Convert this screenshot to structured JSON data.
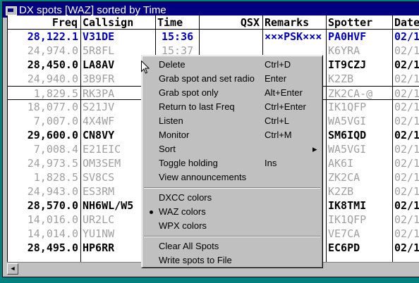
{
  "window": {
    "title": "DX spots [WAZ] sorted by Time"
  },
  "columns": [
    "Freq",
    "Callsign",
    "Time",
    "QSX",
    "Remarks",
    "Spotter",
    "Date"
  ],
  "rows": [
    {
      "freq": "28,122.1",
      "call": "V31DE",
      "time": "15:36",
      "qsx": "",
      "remarks": "×××PSK×××",
      "spotter": "PA0HVF",
      "date": "02/1"
    },
    {
      "freq": "24,974.0",
      "call": "5R8FL",
      "time": "15:37",
      "qsx": "",
      "remarks": "",
      "spotter": "K6YRA",
      "date": "02/1"
    },
    {
      "freq": "28,450.0",
      "call": "LA8AV",
      "time": "",
      "qsx": "",
      "remarks": "",
      "spotter": "IT9CZJ",
      "date": "02/1"
    },
    {
      "freq": "24,940.0",
      "call": "3B9FR",
      "time": "",
      "qsx": "",
      "remarks": "",
      "spotter": "K2ZB",
      "date": "02/1"
    },
    {
      "freq": "1,829.5",
      "call": "RK3PA",
      "time": "",
      "qsx": "",
      "remarks": "",
      "spotter": "ZK2CA-@",
      "date": "02/1"
    },
    {
      "freq": "18,077.0",
      "call": "S21JV",
      "time": "",
      "qsx": "",
      "remarks": "",
      "spotter": "IK1QFP",
      "date": "02/1"
    },
    {
      "freq": "7,007.0",
      "call": "4X4WF",
      "time": "",
      "qsx": "",
      "remarks": "",
      "spotter": "WA5VGI",
      "date": "02/1"
    },
    {
      "freq": "29,600.0",
      "call": "CN8VY",
      "time": "",
      "qsx": "",
      "remarks": "",
      "spotter": "SM6IQD",
      "date": "02/1"
    },
    {
      "freq": "7,008.4",
      "call": "E21EIC",
      "time": "",
      "qsx": "",
      "remarks": "",
      "spotter": "WA5VGI",
      "date": "02/1"
    },
    {
      "freq": "24,973.5",
      "call": "OM3SEM",
      "time": "",
      "qsx": "",
      "remarks": "",
      "spotter": "AK6I",
      "date": "02/1"
    },
    {
      "freq": "1,828.5",
      "call": "SV8CS",
      "time": "",
      "qsx": "",
      "remarks": "",
      "spotter": "ZK2CA",
      "date": "02/1"
    },
    {
      "freq": "24,943.0",
      "call": "ES3RM",
      "time": "",
      "qsx": "",
      "remarks": "",
      "spotter": "K2ZB",
      "date": "02/1"
    },
    {
      "freq": "28,570.0",
      "call": "NH6WL/W5",
      "time": "",
      "qsx": "",
      "remarks": "",
      "spotter": "IK8TMI",
      "date": "02/1"
    },
    {
      "freq": "14,016.0",
      "call": "UR2LC",
      "time": "",
      "qsx": "",
      "remarks": "",
      "spotter": "IK1QFP",
      "date": "02/1"
    },
    {
      "freq": "14,014.0",
      "call": "YU1NW",
      "time": "",
      "qsx": "",
      "remarks": "",
      "spotter": "VE7CA",
      "date": "02/1"
    },
    {
      "freq": "28,495.0",
      "call": "HP6RR",
      "time": "",
      "qsx": "",
      "remarks": "",
      "spotter": "EC6PD",
      "date": "02/1"
    }
  ],
  "row_colors": {
    "blue": "#0000c0",
    "black": "#000000",
    "gray": "#a0a0a0"
  },
  "row_styles": [
    "blue",
    "gray",
    "black",
    "gray",
    "gray",
    "gray",
    "gray",
    "black",
    "gray",
    "gray",
    "gray",
    "gray",
    "black",
    "gray",
    "gray",
    "black"
  ],
  "context_menu": {
    "groups": [
      [
        {
          "label": "Delete",
          "shortcut": "Ctrl+D"
        },
        {
          "label": "Grab spot and set radio",
          "shortcut": "Enter"
        },
        {
          "label": "Grab spot only",
          "shortcut": "Alt+Enter"
        },
        {
          "label": "Return to last Freq",
          "shortcut": "Ctrl+Enter"
        },
        {
          "label": "Listen",
          "shortcut": "Ctrl+L"
        },
        {
          "label": "Monitor",
          "shortcut": "Ctrl+M"
        },
        {
          "label": "Sort",
          "shortcut": "",
          "submenu": true
        },
        {
          "label": "Toggle holding",
          "shortcut": "Ins"
        },
        {
          "label": "View announcements",
          "shortcut": ""
        }
      ],
      [
        {
          "label": "DXCC colors",
          "shortcut": ""
        },
        {
          "label": "WAZ colors",
          "shortcut": "",
          "checked": true
        },
        {
          "label": "WPX colors",
          "shortcut": ""
        }
      ],
      [
        {
          "label": "Clear All Spots",
          "shortcut": ""
        },
        {
          "label": "Write spots to File",
          "shortcut": ""
        }
      ]
    ]
  },
  "icons": {
    "title": "app-window-icon",
    "scroll_left": "triangle-left-icon",
    "submenu": "triangle-right-icon",
    "cursor": "mouse-pointer-icon"
  }
}
